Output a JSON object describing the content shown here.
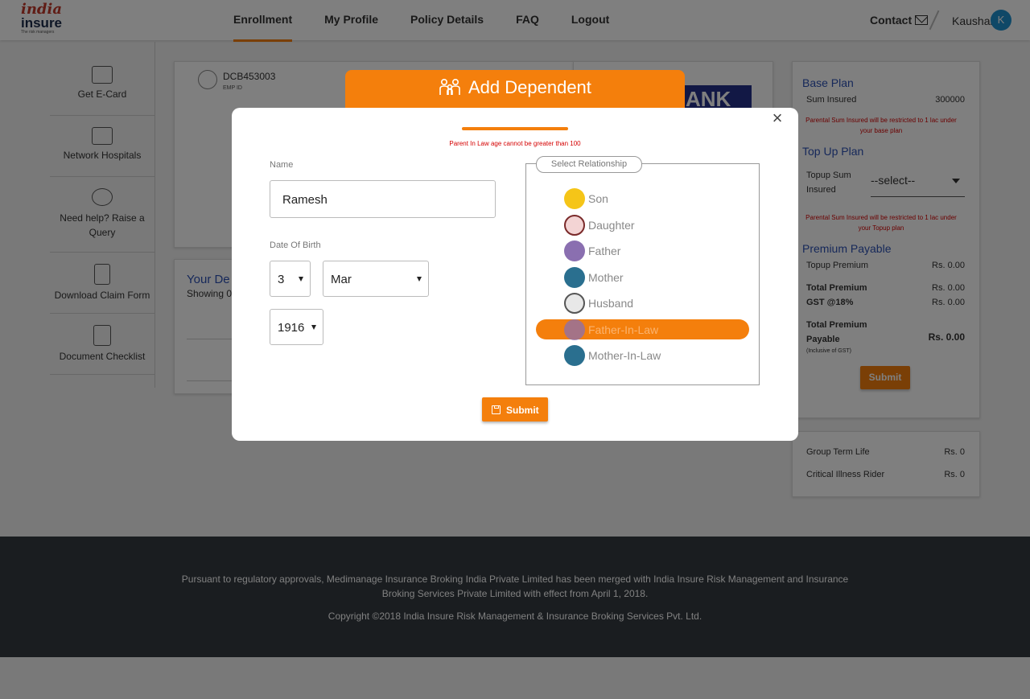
{
  "brand": {
    "logo_line1": "india",
    "logo_line2": "insure",
    "logo_tagline": "The risk managers"
  },
  "nav": {
    "items": [
      {
        "label": "Enrollment",
        "active": true
      },
      {
        "label": "My Profile",
        "active": false
      },
      {
        "label": "Policy Details",
        "active": false
      },
      {
        "label": "FAQ",
        "active": false
      },
      {
        "label": "Logout",
        "active": false
      }
    ],
    "contact_label": "Contact",
    "user_name": "Kaushal",
    "avatar_initial": "K"
  },
  "sidebar": {
    "items": [
      {
        "label": "Get E-Card",
        "icon": "id-card-icon"
      },
      {
        "label": "Network Hospitals",
        "icon": "hospital-icon"
      },
      {
        "label": "Need help? Raise a Query",
        "icon": "help-chat-icon"
      },
      {
        "label": "Download Claim Form",
        "icon": "document-download-icon"
      },
      {
        "label": "Document Checklist",
        "icon": "checklist-icon"
      }
    ]
  },
  "employee": {
    "emp_id": "DCB453003",
    "emp_id_label": "EMP ID",
    "bank_text": "ANK"
  },
  "dependents": {
    "title": "Your De",
    "showing": "Showing 0"
  },
  "plan_panel": {
    "base_plan_title": "Base Plan",
    "sum_insured_label": "Sum Insured",
    "sum_insured_value": "300000",
    "base_note": "Parental Sum Insured will be restricted to 1 lac under your base plan",
    "topup_title": "Top Up Plan",
    "topup_sum_label_1": "Topup Sum",
    "topup_sum_label_2": "Insured",
    "topup_select_value": "--select--",
    "topup_note": "Parental Sum Insured will be restricted to 1 lac under your Topup plan",
    "premium_title": "Premium Payable",
    "topup_premium_label": "Topup Premium",
    "topup_premium_value": "Rs. 0.00",
    "total_premium_label": "Total Premium",
    "total_premium_value": "Rs. 0.00",
    "gst_label": "GST @18%",
    "gst_value": "Rs. 0.00",
    "total_payable_label_1": "Total Premium",
    "total_payable_label_2": "Payable",
    "total_payable_sub": "(Inclusive of GST)",
    "total_payable_value": "Rs. 0.00",
    "submit_label": "Submit"
  },
  "riders": {
    "items": [
      {
        "label": "Group Term Life",
        "value": "Rs. 0"
      },
      {
        "label": "Critical Illness Rider",
        "value": "Rs. 0"
      }
    ]
  },
  "footer": {
    "merger_text": "Pursuant to regulatory approvals, Medimanage Insurance Broking India Private Limited has been merged with India Insure Risk Management and Insurance Broking Services Private Limited with effect from April 1, 2018.",
    "copyright": "Copyright ©2018 India Insure Risk Management & Insurance Broking Services Pvt. Ltd."
  },
  "modal": {
    "title": "Add Dependent",
    "close_label": "×",
    "error_message": "Parent In Law age cannot be greater than 100",
    "progress_fraction": 1.0,
    "name_label": "Name",
    "name_value": "Ramesh",
    "dob_label": "Date Of Birth",
    "dob_day": "3",
    "dob_month": "Mar",
    "dob_year": "1916",
    "relationship_legend": "Select Relationship",
    "relationships": [
      {
        "label": "Son",
        "selected": false,
        "color": "#f5c518"
      },
      {
        "label": "Daughter",
        "selected": false,
        "color": "#e8a3a3"
      },
      {
        "label": "Father",
        "selected": false,
        "color": "#8a6fb0"
      },
      {
        "label": "Mother",
        "selected": false,
        "color": "#2a6f8f"
      },
      {
        "label": "Husband",
        "selected": false,
        "color": "#d9d9d9"
      },
      {
        "label": "Father-In-Law",
        "selected": true,
        "color": "#8a6fb0"
      },
      {
        "label": "Mother-In-Law",
        "selected": false,
        "color": "#2a6f8f"
      }
    ],
    "submit_label": "Submit"
  },
  "colors": {
    "accent": "#f47f0c",
    "link_blue": "#2c51b4",
    "error_red": "#d50000",
    "footer_bg": "#343a40"
  }
}
